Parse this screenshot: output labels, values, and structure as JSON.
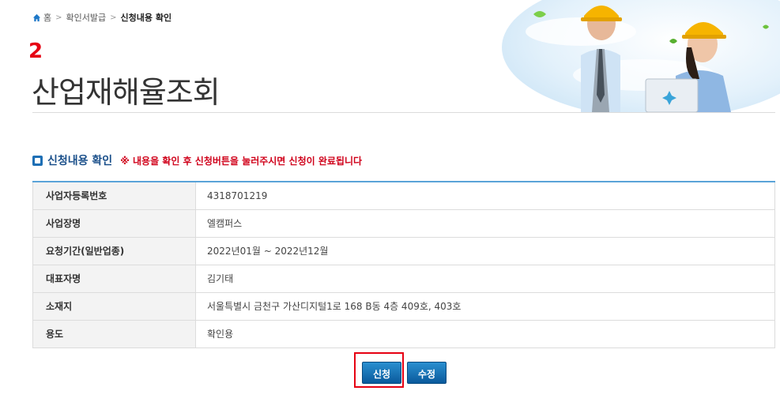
{
  "breadcrumb": {
    "home": "홈",
    "level1": "확인서발급",
    "current": "신청내용 확인"
  },
  "step_number": "2",
  "page_title": "산업재해율조회",
  "section": {
    "title": "신청내용 확인",
    "notice": "※ 내용을 확인 후 신청버튼을 눌러주시면 신청이 완료됩니다"
  },
  "rows": [
    {
      "label": "사업자등록번호",
      "value": "4318701219"
    },
    {
      "label": "사업장명",
      "value": "엘캠퍼스"
    },
    {
      "label": "요청기간(일반업종)",
      "value": "2022년01월 ~ 2022년12월"
    },
    {
      "label": "대표자명",
      "value": "김기태"
    },
    {
      "label": "소재지",
      "value": "서울특별시 금천구 가산디지털1로 168 B동 4층 409호, 403호"
    },
    {
      "label": "용도",
      "value": "확인용"
    }
  ],
  "buttons": {
    "apply": "신청",
    "edit": "수정"
  },
  "colors": {
    "accent": "#1e6fb5",
    "notice": "#d0021b",
    "highlight": "#e60012"
  }
}
